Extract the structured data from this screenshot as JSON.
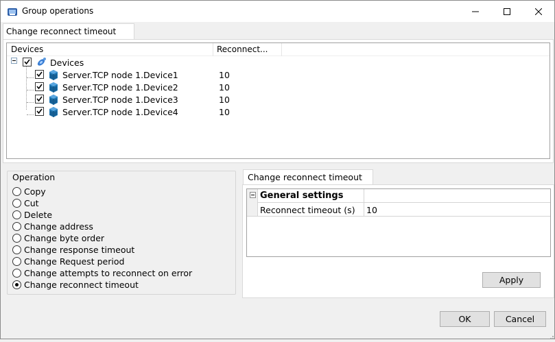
{
  "window": {
    "title": "Group operations"
  },
  "top_tab": {
    "label": "Change reconnect timeout"
  },
  "tree": {
    "columns": [
      "Devices",
      "Reconnect..."
    ],
    "root": {
      "label": "Devices",
      "checked": true
    },
    "items": [
      {
        "label": "Server.TCP node 1.Device1",
        "value": "10",
        "checked": true
      },
      {
        "label": "Server.TCP node 1.Device2",
        "value": "10",
        "checked": true
      },
      {
        "label": "Server.TCP node 1.Device3",
        "value": "10",
        "checked": true
      },
      {
        "label": "Server.TCP node 1.Device4",
        "value": "10",
        "checked": true
      }
    ]
  },
  "operation": {
    "title": "Operation",
    "options": [
      "Copy",
      "Cut",
      "Delete",
      "Change address",
      "Change byte order",
      "Change response timeout",
      "Change Request period",
      "Change attempts to reconnect on error",
      "Change reconnect timeout"
    ],
    "selected": "Change reconnect timeout"
  },
  "right_tab": {
    "label": "Change reconnect timeout"
  },
  "properties": {
    "category": "General settings",
    "rows": [
      {
        "name": "Reconnect timeout (s)",
        "value": "10"
      }
    ]
  },
  "buttons": {
    "apply": "Apply",
    "ok": "OK",
    "cancel": "Cancel"
  },
  "colors": {
    "device_icon": "#1f78b4",
    "root_icon": "#2a66c9"
  }
}
